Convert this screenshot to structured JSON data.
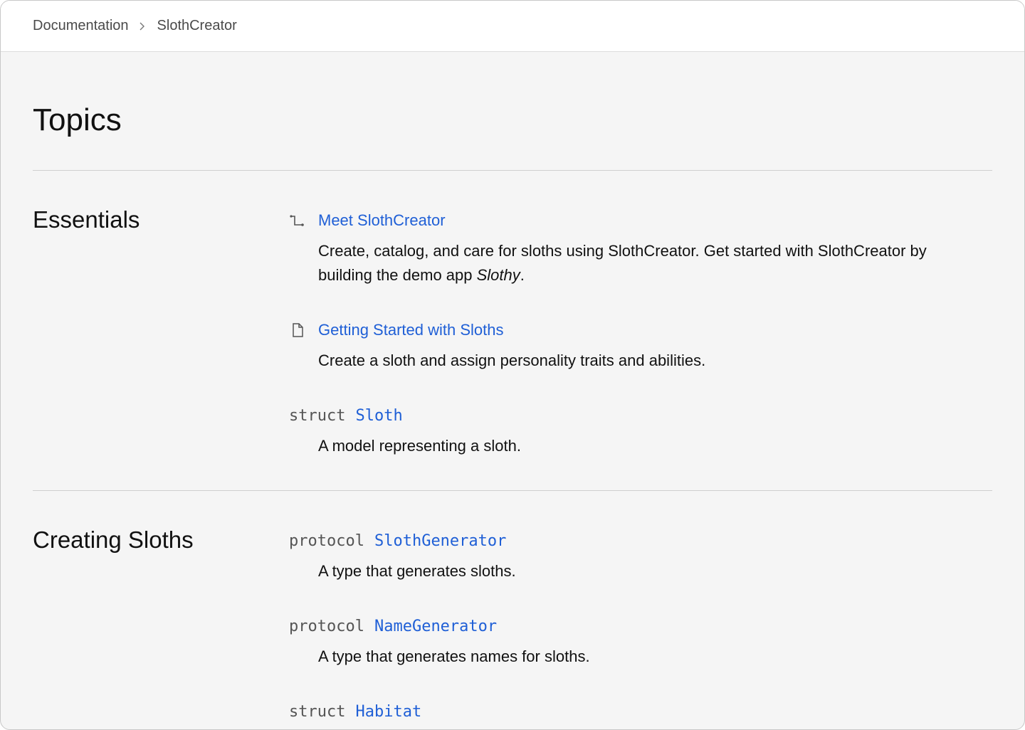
{
  "breadcrumb": {
    "items": [
      "Documentation",
      "SlothCreator"
    ],
    "separator_icon": "chevron-right-icon"
  },
  "page": {
    "title": "Topics"
  },
  "sections": [
    {
      "title": "Essentials",
      "items": [
        {
          "kind": "tutorial",
          "icon": "tutorial-icon",
          "title": "Meet SlothCreator",
          "abstract_prefix": "Create, catalog, and care for sloths using SlothCreator. Get started with SlothCreator by building the demo app ",
          "abstract_em": "Slothy",
          "abstract_suffix": "."
        },
        {
          "kind": "article",
          "icon": "document-icon",
          "title": "Getting Started with Sloths",
          "abstract": "Create a sloth and assign personality traits and abilities."
        },
        {
          "kind": "symbol",
          "keyword": "struct",
          "title": "Sloth",
          "abstract": "A model representing a sloth."
        }
      ]
    },
    {
      "title": "Creating Sloths",
      "items": [
        {
          "kind": "symbol",
          "keyword": "protocol",
          "title": "SlothGenerator",
          "abstract": "A type that generates sloths."
        },
        {
          "kind": "symbol",
          "keyword": "protocol",
          "title": "NameGenerator",
          "abstract": "A type that generates names for sloths."
        },
        {
          "kind": "symbol",
          "keyword": "struct",
          "title": "Habitat",
          "abstract": ""
        }
      ]
    }
  ],
  "colors": {
    "link": "#1f5fd6",
    "background": "#f5f5f5",
    "header_background": "#ffffff"
  }
}
